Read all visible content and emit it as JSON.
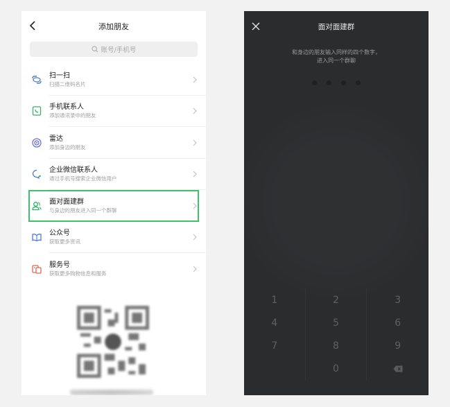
{
  "left": {
    "title": "添加朋友",
    "search_placeholder": "账号/手机号",
    "items": [
      {
        "title": "扫一扫",
        "subtitle": "扫描二维码名片",
        "icon": "scan-icon"
      },
      {
        "title": "手机联系人",
        "subtitle": "添加通讯录中的朋友",
        "icon": "phone-contacts-icon"
      },
      {
        "title": "雷达",
        "subtitle": "添加身边的朋友",
        "icon": "radar-icon"
      },
      {
        "title": "企业微信联系人",
        "subtitle": "通过手机号搜索企业微信用户",
        "icon": "wecom-icon"
      },
      {
        "title": "面对面建群",
        "subtitle": "与身边的朋友进入同一个群聊",
        "icon": "face-to-face-group-icon"
      },
      {
        "title": "公众号",
        "subtitle": "获取更多资讯",
        "icon": "official-account-icon"
      },
      {
        "title": "服务号",
        "subtitle": "获取更多购物信息和服务",
        "icon": "service-account-icon"
      }
    ]
  },
  "right": {
    "title": "面对面建群",
    "hint_line1": "和身边的朋友输入同样的四个数字，",
    "hint_line2": "进入同一个群聊",
    "keys": [
      "1",
      "2",
      "3",
      "4",
      "5",
      "6",
      "7",
      "8",
      "9",
      "",
      "0",
      ""
    ]
  },
  "colors": {
    "highlight": "#3cc36a",
    "dark_bg": "#2b2c2e",
    "icon_blue": "#4a7fd6",
    "icon_green": "#2fb36a",
    "icon_orange": "#e2674a"
  }
}
